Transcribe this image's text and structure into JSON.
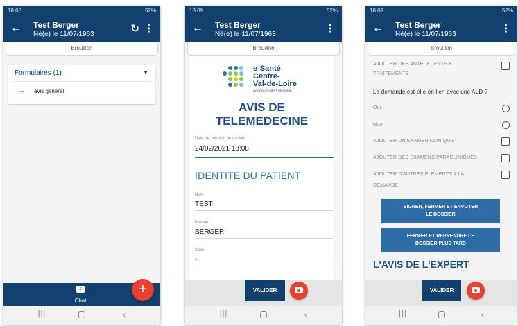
{
  "header": {
    "title": "Test Berger",
    "subtitle": "Né(e) le 11/07/1963",
    "draft_label": "Brouillon"
  },
  "statusbars": [
    {
      "time": "18:08",
      "right": "52%"
    },
    {
      "time": "18:09",
      "right": "52%"
    },
    {
      "time": "18:09",
      "right": "52%"
    }
  ],
  "screen1": {
    "forms_header": "Formulaires (1)",
    "form_item": "avis general",
    "chat_label": "Chat",
    "fab_label": "+"
  },
  "screen2": {
    "logo": {
      "line1": "e-Santé",
      "line2": "Centre-",
      "line3": "Val-de-Loire",
      "tagline": "LE GROUPEMENT RÉGIONAL"
    },
    "title_line1": "AVIS DE",
    "title_line2": "TELEMEDECINE",
    "created_label": "Date de création du dossier",
    "created_value": "24/02/2021 18:08",
    "section_title": "IDENTITE DU PATIENT",
    "fields": [
      {
        "label": "Nom",
        "value": "TEST"
      },
      {
        "label": "Prénom",
        "value": "BERGER"
      },
      {
        "label": "Sexe",
        "value": "F"
      }
    ],
    "valider_label": "VALIDER"
  },
  "screen3": {
    "antecedents_line1": "AJOUTER DES ANTECEDENTS ET",
    "antecedents_line2": "TRAITEMENTS",
    "ald_question": "La demande est-elle en lien avec une ALD ?",
    "yes": "Oui",
    "no": "Non",
    "exam_clinique": "AJOUTER UN EXAMEN CLINIQUE",
    "exams_para": "AJOUTER DES EXAMENS PARACLINIQUES",
    "autres_line1": "AJOUTER D'AUTRES ELEMENTS A LA",
    "autres_line2": "DEMANDE",
    "sign_line1": "SIGNER, FERMER ET ENVOYER",
    "sign_line2": "LE DOSSIER",
    "close_line1": "FERMER ET REPRENDRE LE",
    "close_line2": "DOSSIER PLUS TARD",
    "expert_title": "L'AVIS DE L'EXPERT",
    "valider_label": "VALIDER"
  },
  "icons": {
    "back": "arrow-back-icon",
    "refresh": "refresh-icon",
    "more": "more-vert-icon",
    "chat": "chat-icon",
    "camera": "camera-icon",
    "nav_recent": "recent-apps-icon",
    "nav_home": "home-icon",
    "nav_back": "nav-back-icon"
  },
  "colors": {
    "primary": "#12406f",
    "accent": "#e9412f",
    "button_blue": "#2e6ca5"
  }
}
